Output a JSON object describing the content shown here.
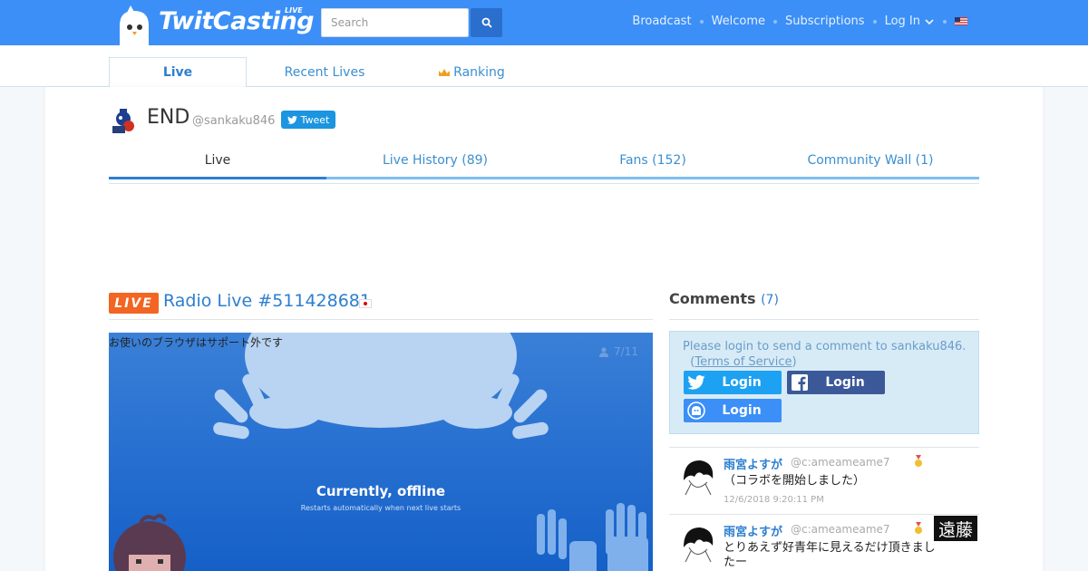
{
  "header": {
    "brand": "TwitCasting",
    "brand_tag": "LIVE",
    "search_placeholder": "Search",
    "nav": [
      "Broadcast",
      "Welcome",
      "Subscriptions",
      "Log In"
    ],
    "colors": {
      "bar": "#3b8ff7",
      "search_button": "#2a6fce"
    }
  },
  "tabs": {
    "live": "Live",
    "recent": "Recent Lives",
    "ranking": "Ranking"
  },
  "user": {
    "name": "END",
    "handle": "@sankaku846",
    "tweet_label": "Tweet"
  },
  "subtabs": [
    "Live",
    "Live History (89)",
    "Fans (152)",
    "Community Wall (1)"
  ],
  "live": {
    "badge": "LIVE",
    "title": "Radio Live #511428681",
    "unsupported_msg": "お使いのブラウザはサポート外です",
    "viewers": "7/11",
    "offline_title": "Currently, offline",
    "offline_sub": "Restarts automatically when next live starts"
  },
  "comments": {
    "heading": "Comments",
    "count_open": "(",
    "count": "7",
    "count_close": ")",
    "login_prompt": "Please login to send a comment to sankaku846.",
    "tos_open": "(",
    "tos": "Terms of Service",
    "tos_close": ")",
    "login_twitter": "Login",
    "login_facebook": "Login",
    "login_twitcasting": "Login",
    "items": [
      {
        "name": "雨宮よすが",
        "handle": "@c:ameameame7",
        "text": "（コラボを開始しました）",
        "time": "12/6/2018 9:20:11 PM",
        "sticker": ""
      },
      {
        "name": "雨宮よすが",
        "handle": "@c:ameameame7",
        "text": "とりあえず好青年に見えるだけ頂きましたー",
        "time": "",
        "sticker": "遠藤"
      }
    ]
  }
}
